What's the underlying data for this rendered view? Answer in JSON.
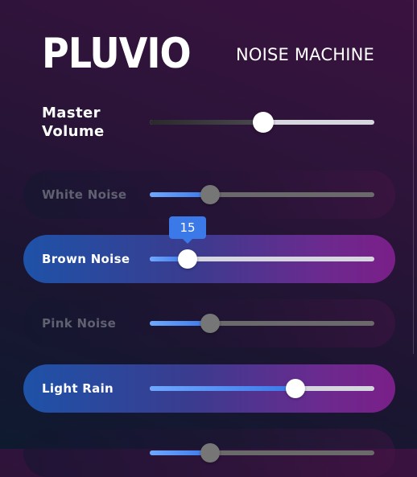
{
  "app": {
    "logo": "PLUVIO",
    "subtitle": "NOISE MACHINE"
  },
  "master": {
    "label": "Master\nVolume",
    "value_fraction": 0.505
  },
  "tooltip": {
    "text": "15"
  },
  "sounds": [
    {
      "label": "White Noise",
      "active": false,
      "value_fraction": 0.27
    },
    {
      "label": "Brown Noise",
      "active": true,
      "value_fraction": 0.17
    },
    {
      "label": "Pink Noise",
      "active": false,
      "value_fraction": 0.27
    },
    {
      "label": "Light Rain",
      "active": true,
      "value_fraction": 0.65
    },
    {
      "label": "",
      "active": false,
      "value_fraction": 0.27
    }
  ],
  "colors": {
    "accent_blue": "#3b78e8",
    "track_light": "#d6d6de",
    "track_dark": "#6a6a6a",
    "thumb_white": "#ffffff",
    "thumb_gray": "#767676"
  }
}
